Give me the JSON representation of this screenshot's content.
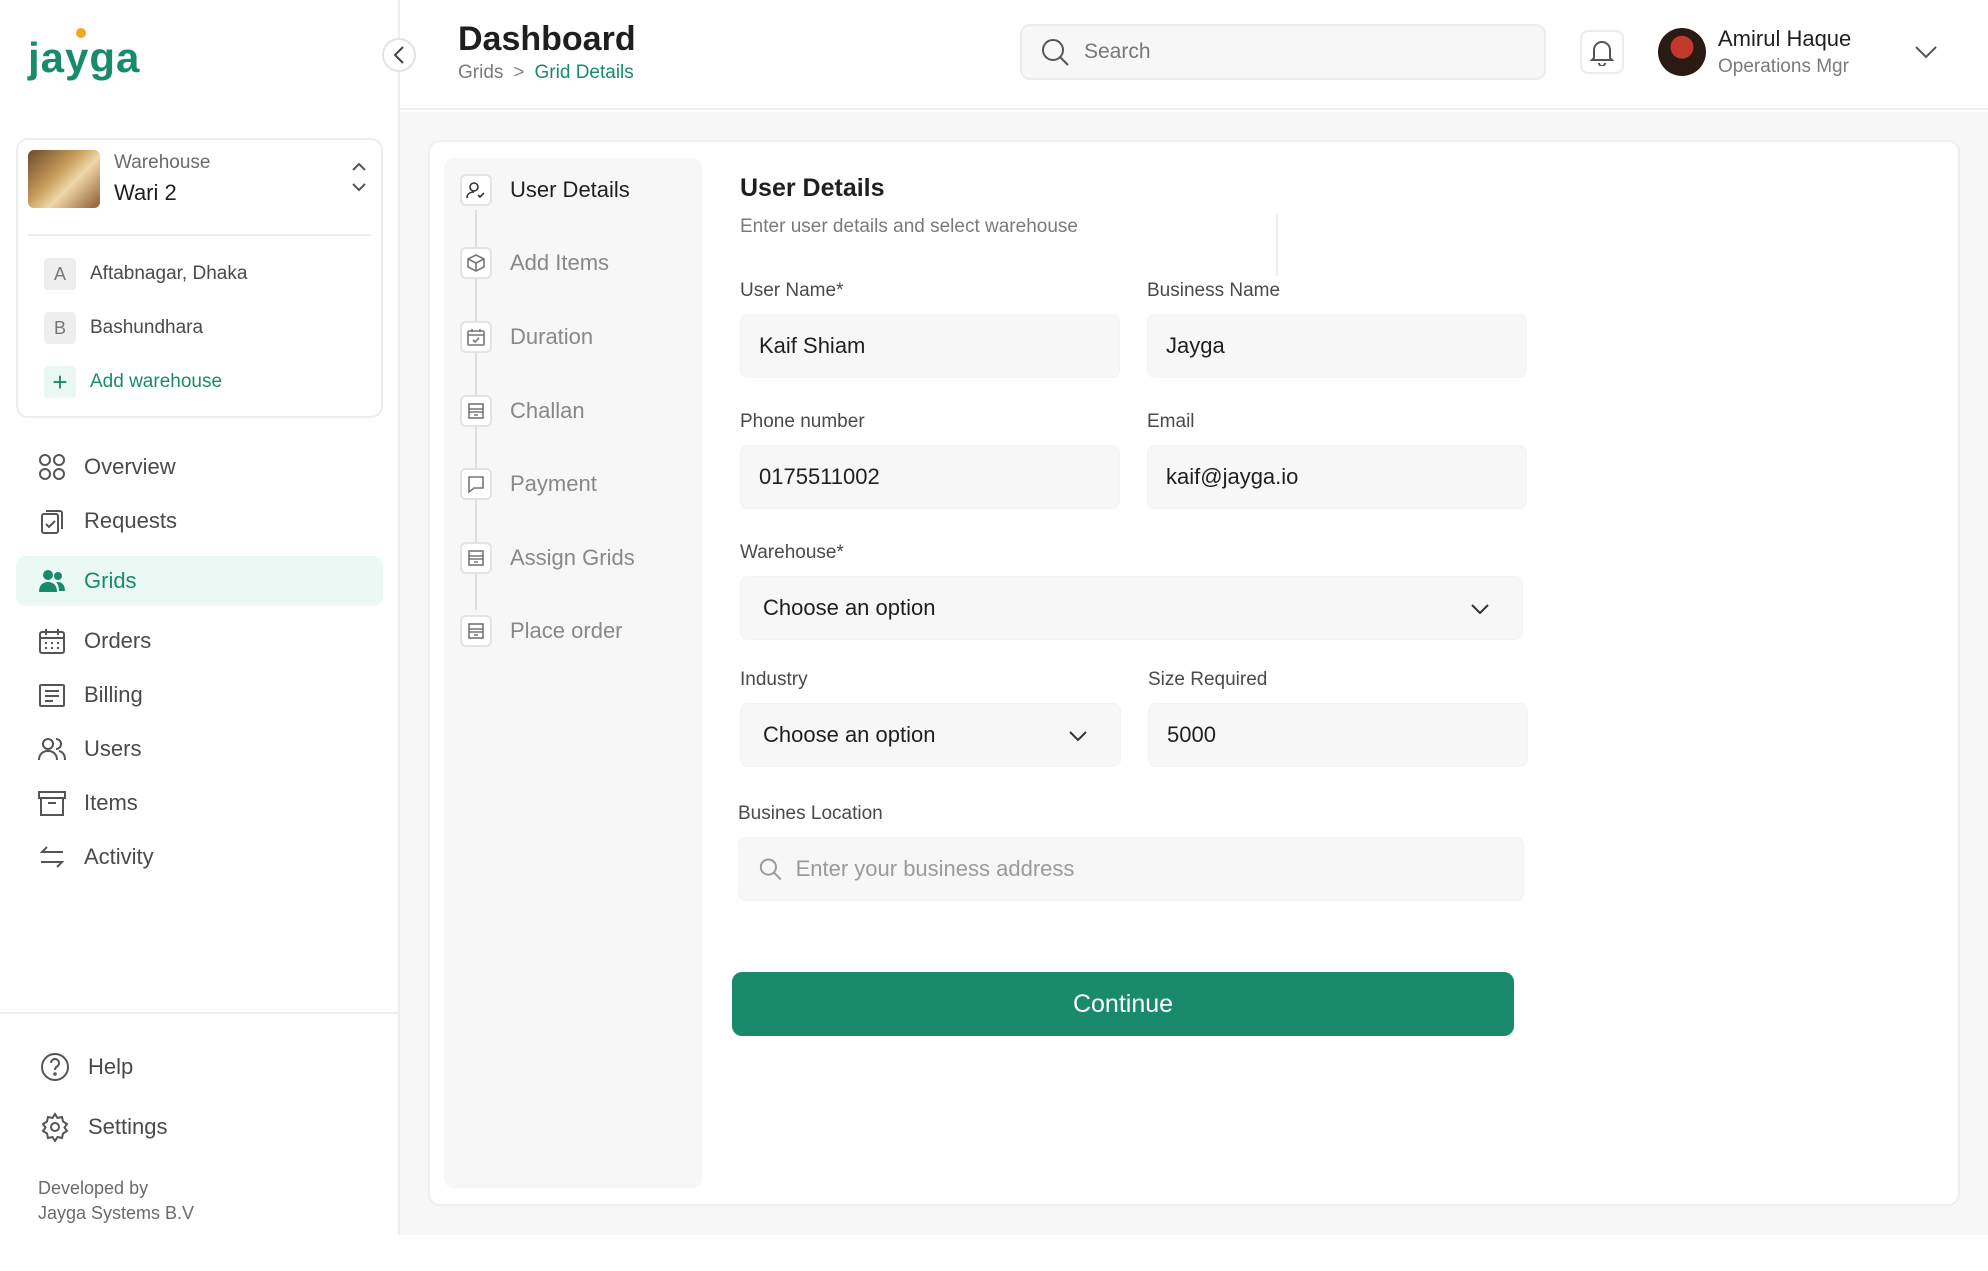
{
  "brand": {
    "logo_text": "jayga"
  },
  "warehouse": {
    "label": "Warehouse",
    "name": "Wari 2",
    "items": [
      {
        "badge": "A",
        "label": "Aftabnagar, Dhaka"
      },
      {
        "badge": "B",
        "label": "Bashundhara"
      }
    ],
    "add_label": "Add warehouse"
  },
  "nav": {
    "items": [
      {
        "label": "Overview",
        "icon": "grid-icon"
      },
      {
        "label": "Requests",
        "icon": "clipboard-icon"
      },
      {
        "label": "Grids",
        "icon": "users-icon"
      },
      {
        "label": "Orders",
        "icon": "calendar-icon"
      },
      {
        "label": "Billing",
        "icon": "receipt-icon"
      },
      {
        "label": "Users",
        "icon": "people-icon"
      },
      {
        "label": "Items",
        "icon": "archive-icon"
      },
      {
        "label": "Activity",
        "icon": "arrows-icon"
      }
    ],
    "active": "Grids"
  },
  "footer": {
    "help_label": "Help",
    "settings_label": "Settings",
    "dev_line1": "Developed by",
    "dev_line2": "Jayga Systems B.V"
  },
  "header": {
    "title": "Dashboard",
    "breadcrumb": [
      "Grids",
      "Grid Details"
    ],
    "breadcrumb_sep": ">",
    "search_placeholder": "Search",
    "user_name": "Amirul Haque",
    "user_role": "Operations Mgr"
  },
  "steps": [
    {
      "label": "User Details",
      "icon": "user-icon",
      "active": true
    },
    {
      "label": "Add Items",
      "icon": "box-icon"
    },
    {
      "label": "Duration",
      "icon": "calendar-check-icon"
    },
    {
      "label": "Challan",
      "icon": "store-icon"
    },
    {
      "label": "Payment",
      "icon": "message-icon"
    },
    {
      "label": "Assign Grids",
      "icon": "store-icon"
    },
    {
      "label": "Place order",
      "icon": "store-icon"
    }
  ],
  "form": {
    "title": "User Details",
    "subtitle": "Enter user details and select warehouse",
    "user_name_label": "User Name*",
    "user_name_value": "Kaif Shiam",
    "business_name_label": "Business Name",
    "business_name_value": "Jayga",
    "phone_label": "Phone number",
    "phone_value": "0175511002",
    "email_label": "Email",
    "email_value": "kaif@jayga.io",
    "warehouse_label": "Warehouse*",
    "warehouse_value": "Choose an option",
    "industry_label": "Industry",
    "industry_value": "Choose an option",
    "size_label": "Size Required",
    "size_value": "5000",
    "location_label": "Busines Location",
    "location_placeholder": "Enter your business address",
    "continue_label": "Continue"
  },
  "colors": {
    "accent": "#1a8a6d",
    "accent_light": "#eaf9f3",
    "logo_dot": "#f5a623"
  }
}
